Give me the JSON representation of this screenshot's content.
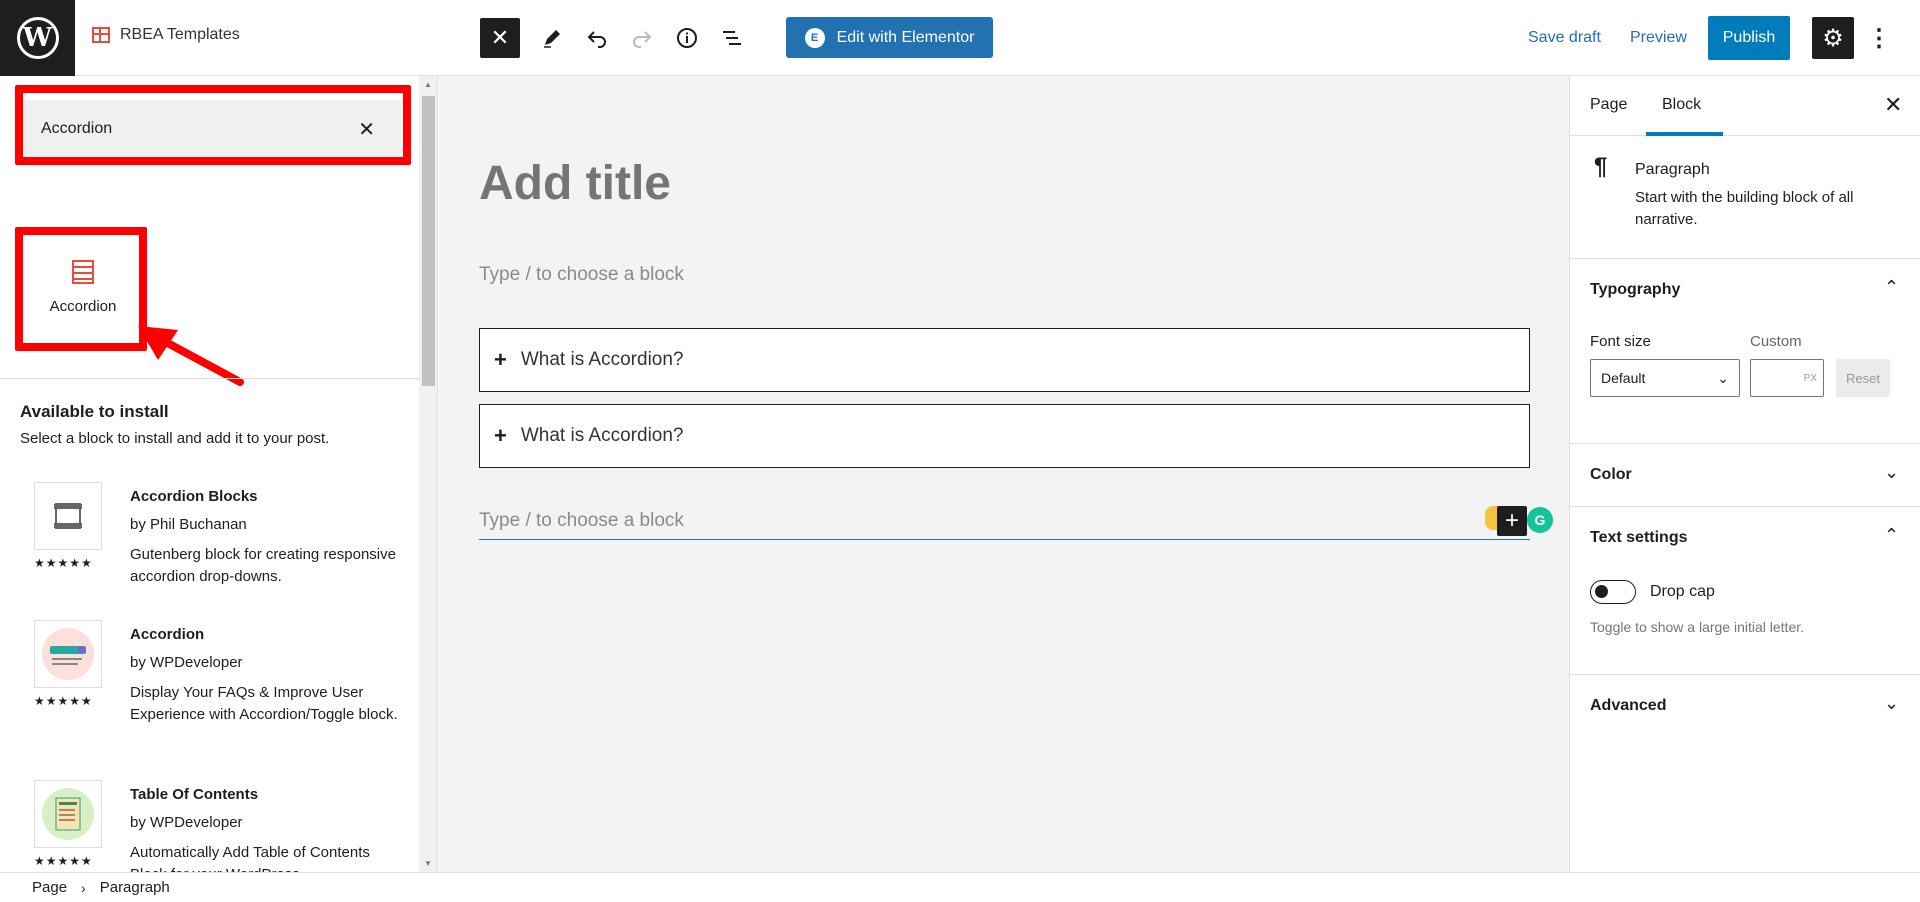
{
  "header": {
    "logo_letter": "W",
    "site_name": "RBEA Templates",
    "elementor_label": "Edit with Elementor",
    "elementor_icon": "E",
    "save_draft": "Save draft",
    "preview": "Preview",
    "publish": "Publish"
  },
  "inserter": {
    "search_value": "Accordion",
    "result_label": "Accordion",
    "install_title": "Available to install",
    "install_desc": "Select a block to install and add it to your post.",
    "plugins": [
      {
        "name": "Accordion Blocks",
        "author": "by Phil Buchanan",
        "desc": "Gutenberg block for creating responsive accordion drop-downs.",
        "stars": "★★★★★"
      },
      {
        "name": "Accordion",
        "author": "by WPDeveloper",
        "desc": "Display Your FAQs & Improve User Experience with Accordion/Toggle block.",
        "stars": "★★★★★"
      },
      {
        "name": "Table Of Contents",
        "author": "by WPDeveloper",
        "desc": "Automatically Add Table of Contents Block for your WordPress",
        "stars": "★★★★★"
      }
    ]
  },
  "canvas": {
    "title_placeholder": "Add title",
    "paragraph_placeholder": "Type / to choose a block",
    "accordion_items": [
      "What is Accordion?",
      "What is Accordion?"
    ],
    "paragraph_placeholder_2": "Type / to choose a block"
  },
  "sidebar": {
    "tab_page": "Page",
    "tab_block": "Block",
    "block_name": "Paragraph",
    "block_desc": "Start with the building block of all narrative.",
    "typography_title": "Typography",
    "font_size_label": "Font size",
    "custom_label": "Custom",
    "font_size_value": "Default",
    "unit": "PX",
    "reset": "Reset",
    "color_title": "Color",
    "text_settings_title": "Text settings",
    "drop_cap_label": "Drop cap",
    "drop_cap_help": "Toggle to show a large initial letter.",
    "advanced_title": "Advanced"
  },
  "footer": {
    "crumb_1": "Page",
    "crumb_2": "Paragraph"
  },
  "colors": {
    "accent": "#007cba",
    "elementor": "#2271b1",
    "highlight": "#ff0000",
    "block_icon": "#e74c3c"
  }
}
